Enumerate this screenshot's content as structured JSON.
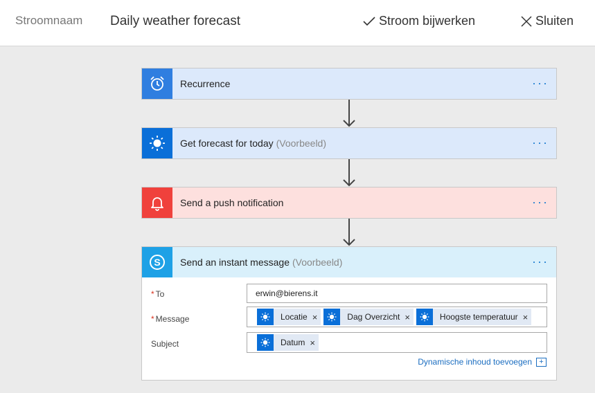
{
  "header": {
    "flow_label": "Stroomnaam",
    "flow_name": "Daily weather forecast",
    "update_label": "Stroom bijwerken",
    "close_label": "Sluiten"
  },
  "steps": [
    {
      "title": "Recurrence",
      "subtitle": "",
      "icon": "alarm-clock-icon",
      "color": "#2f7ee0"
    },
    {
      "title": "Get forecast for today",
      "subtitle": "(Voorbeeld)",
      "icon": "sun-icon",
      "color": "#0a6fd8"
    },
    {
      "title": "Send a push notification",
      "subtitle": "",
      "icon": "bell-icon",
      "color": "#f0413c"
    },
    {
      "title": "Send an instant message",
      "subtitle": "(Voorbeeld)",
      "icon": "skype-icon",
      "color": "#1ea1e6"
    }
  ],
  "more_label": "···",
  "message_form": {
    "to": {
      "required_mark": "*",
      "label": "To",
      "value": "erwin@bierens.it"
    },
    "message": {
      "required_mark": "*",
      "label": "Message",
      "tokens": [
        "Locatie",
        "Dag Overzicht",
        "Hoogste temperatuur"
      ]
    },
    "subject": {
      "label": "Subject",
      "tokens": [
        "Datum"
      ]
    },
    "dynamic_link": "Dynamische inhoud toevoegen",
    "dynamic_plus": "+"
  },
  "token_remove_glyph": "×"
}
